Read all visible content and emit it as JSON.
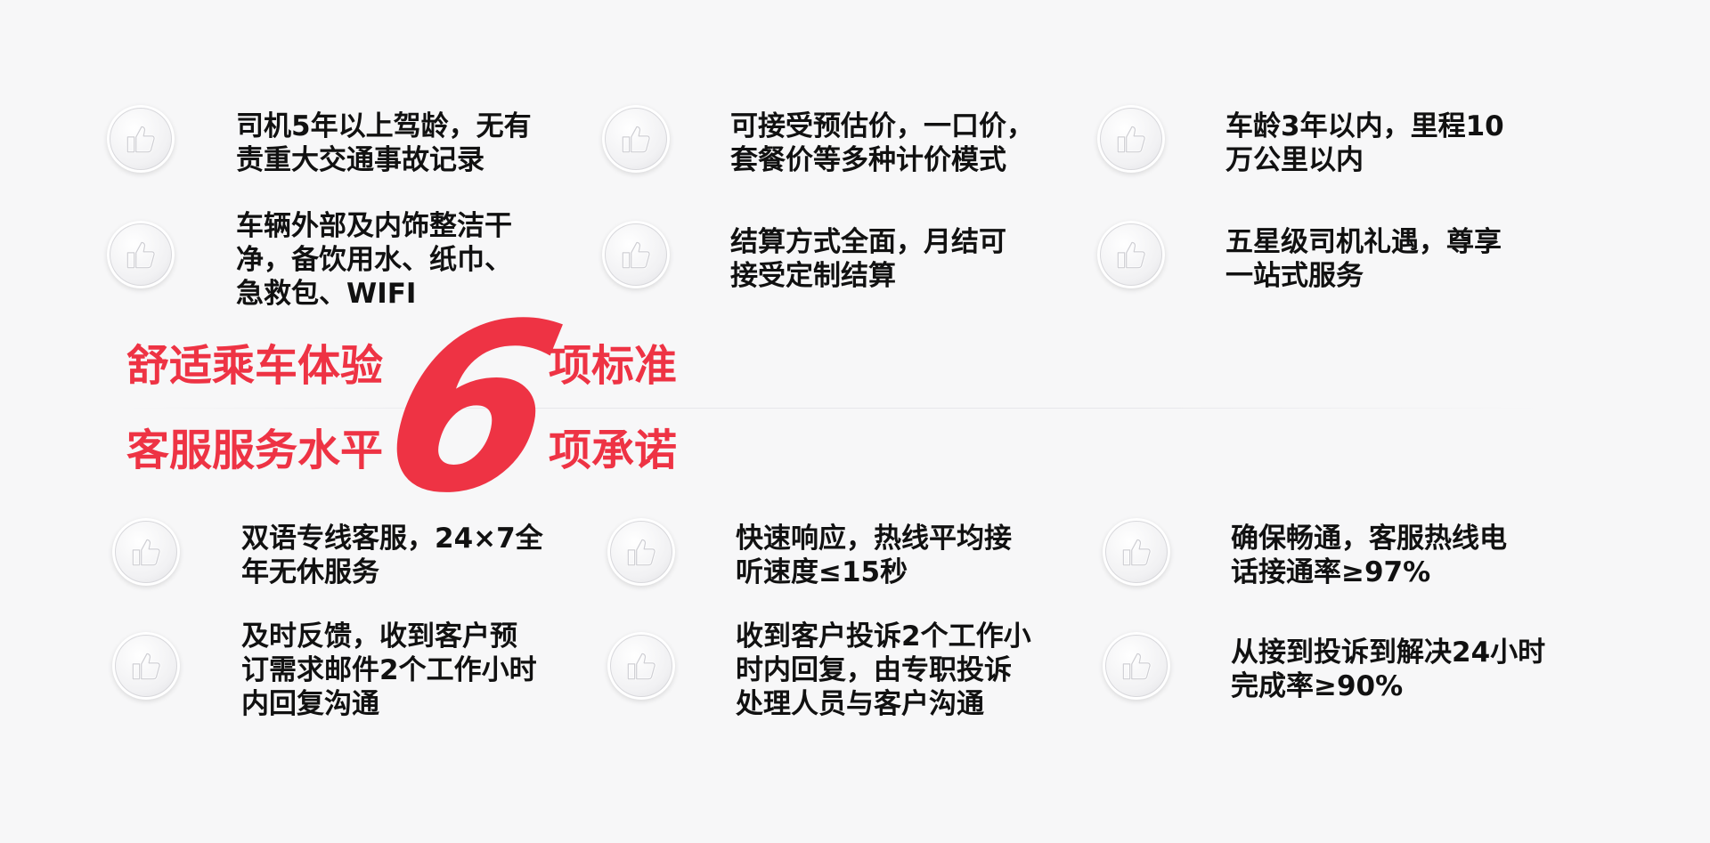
{
  "top_items": [
    {
      "lines": [
        "司机5年以上驾龄，无有",
        "责重大交通事故记录"
      ]
    },
    {
      "lines": [
        "可接受预估价，一口价，",
        "套餐价等多种计价模式"
      ]
    },
    {
      "lines": [
        "车龄3年以内，里程10",
        "万公里以内"
      ]
    },
    {
      "lines": [
        "车辆外部及内饰整洁干",
        "净，备饮用水、纸巾、",
        "急救包、WIFI"
      ]
    },
    {
      "lines": [
        "结算方式全面，月结可",
        "接受定制结算"
      ]
    },
    {
      "lines": [
        "五星级司机礼遇，尊享",
        "一站式服务"
      ]
    }
  ],
  "bottom_items": [
    {
      "lines": [
        "双语专线客服，24×7全",
        "年无休服务"
      ]
    },
    {
      "lines": [
        "快速响应，热线平均接",
        "听速度≤15秒"
      ]
    },
    {
      "lines": [
        "确保畅通，客服热线电",
        "话接通率≥97%"
      ]
    },
    {
      "lines": [
        "及时反馈，收到客户预",
        "订需求邮件2个工作小时",
        "内回复沟通"
      ]
    },
    {
      "lines": [
        "收到客户投诉2个工作小",
        "时内回复，由专职投诉",
        "处理人员与客户沟通"
      ]
    },
    {
      "lines": [
        "从接到投诉到解决24小时",
        "完成率≥90%"
      ]
    }
  ],
  "center": {
    "left_top": "舒适乘车体验",
    "left_bottom": "客服服务水平",
    "big_number": "6",
    "right_top": "项标准",
    "right_bottom": "项承诺"
  },
  "colors": {
    "accent": "#ee3344",
    "text": "#111111",
    "background": "#f7f7f8"
  },
  "icon": "thumbs-up-icon"
}
